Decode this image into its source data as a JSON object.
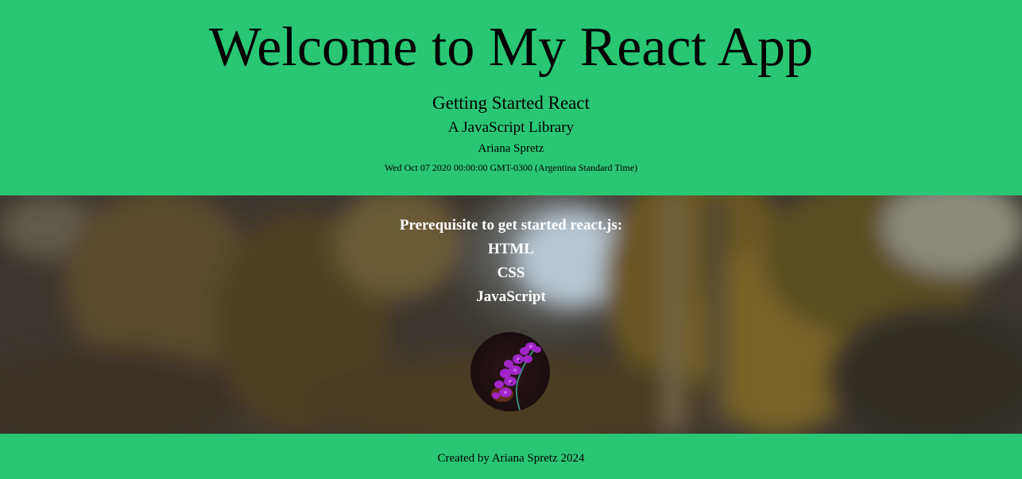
{
  "header": {
    "title": "Welcome to My React App",
    "subtitle": "Getting Started React",
    "tagline": "A JavaScript Library",
    "author": "Ariana Spretz",
    "date": "Wed Oct 07 2020 00:00:00 GMT-0300 (Argentina Standard Time)"
  },
  "main": {
    "prereq_title": "Prerequisite to get started react.js:",
    "prereq_items": [
      "HTML",
      "CSS",
      "JavaScript"
    ],
    "avatar_icon": "orchid-photo"
  },
  "footer": {
    "credit": "Created by Ariana Spretz 2024"
  },
  "colors": {
    "accent": "#29c773",
    "text_dark": "#000000",
    "text_light": "#ffffff"
  }
}
